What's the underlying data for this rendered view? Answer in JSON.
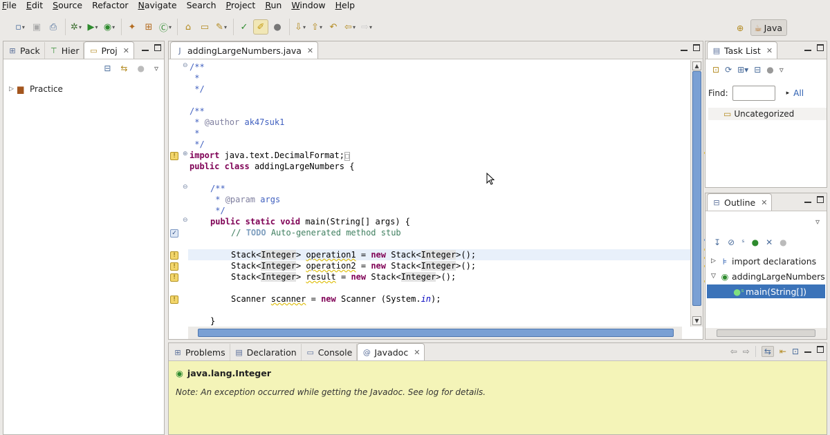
{
  "menubar": {
    "items": [
      {
        "label": "File",
        "u": "F",
        "rest": "ile"
      },
      {
        "label": "Edit",
        "u": "E",
        "rest": "dit"
      },
      {
        "label": "Source",
        "u": "S",
        "rest": "ource"
      },
      {
        "label": "Refactor",
        "u": "",
        "rest": "Refactor"
      },
      {
        "label": "Navigate",
        "u": "N",
        "rest": "avigate"
      },
      {
        "label": "Search",
        "u": "",
        "rest": "Search"
      },
      {
        "label": "Project",
        "u": "P",
        "rest": "roject"
      },
      {
        "label": "Run",
        "u": "R",
        "rest": "un"
      },
      {
        "label": "Window",
        "u": "W",
        "rest": "indow"
      },
      {
        "label": "Help",
        "u": "H",
        "rest": "elp"
      }
    ]
  },
  "perspective": {
    "java_label": "Java"
  },
  "left_view": {
    "tabs": [
      "Pack",
      "Hier",
      "Proj"
    ],
    "tree": [
      {
        "label": "Practice"
      }
    ]
  },
  "editor": {
    "tab_label": "addingLargeNumbers.java",
    "lines": {
      "l1": "/**",
      "l2": " * ",
      "l3": " */",
      "l5": "/**",
      "l6": " * ",
      "l6b": "@author",
      "l6c": " ak47suk1",
      "l7": " * ",
      "l8": " */",
      "l9a": "import",
      "l9b": " java.text.DecimalFormat;",
      "l9c": "□",
      "l10a": "public",
      "l10b": " ",
      "l10c": "class",
      "l10d": " addingLargeNumbers {",
      "l12": "/**",
      "l13a": " * ",
      "l13b": "@param",
      "l13c": " args",
      "l14": " */",
      "l15a": "public",
      "l15b": "static",
      "l15c": "void",
      "l15d": " main(String[] args) {",
      "l16a": "// ",
      "l16b": "TODO",
      "l16c": " Auto-generated method stub",
      "l18a": "Stack<",
      "l18b": "Integer",
      "l18c": "> ",
      "l18d": "operation1",
      "l18e": " = ",
      "l18f": "new",
      "l18g": " Stack<",
      "l18h": "Integer",
      "l18i": ">();",
      "l19a": "Stack<",
      "l19b": "Integer",
      "l19c": "> ",
      "l19d": "operation2",
      "l19e": " = ",
      "l19f": "new",
      "l19g": " Stack<",
      "l19h": "Integer",
      "l19i": ">();",
      "l20a": "Stack<",
      "l20b": "Integer",
      "l20c": "> ",
      "l20d": "result",
      "l20e": " = ",
      "l20f": "new",
      "l20g": " Stack<",
      "l20h": "Integer",
      "l20i": ">();",
      "l22a": "Scanner ",
      "l22b": "scanner",
      "l22c": " = ",
      "l22d": "new",
      "l22e": " Scanner (System.",
      "l22f": "in",
      "l22g": ");",
      "l24": "}"
    }
  },
  "task_list": {
    "tab_label": "Task List",
    "find_label": "Find:",
    "find_value": "",
    "all_label": "All",
    "category": "Uncategorized"
  },
  "outline": {
    "tab_label": "Outline",
    "items": [
      {
        "label": "import declarations"
      },
      {
        "label": "addingLargeNumbers"
      },
      {
        "label": "main(String[])"
      }
    ]
  },
  "bottom": {
    "tabs": [
      "Problems",
      "Declaration",
      "Console",
      "Javadoc"
    ],
    "javadoc_title": "java.lang.Integer",
    "javadoc_note": "Note: An exception occurred while getting the Javadoc. See log for details."
  }
}
